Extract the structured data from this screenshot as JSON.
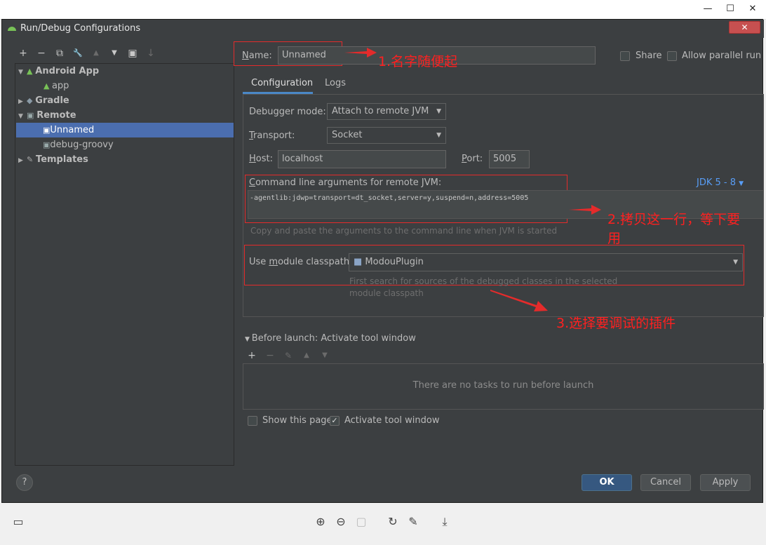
{
  "window": {
    "minimize": "—",
    "maximize": "☐",
    "close": "✕"
  },
  "dialog": {
    "title": "Run/Debug Configurations",
    "close": "✕"
  },
  "toolbar": {
    "add": "+",
    "remove": "−",
    "copy": "⧉",
    "edit": "🔧",
    "up": "▲",
    "down": "▼",
    "folder": "▣",
    "sort": "↓"
  },
  "tree": {
    "android_app": "Android App",
    "app": "app",
    "gradle": "Gradle",
    "remote": "Remote",
    "unnamed": "Unnamed",
    "debug_groovy": "debug-groovy",
    "templates": "Templates"
  },
  "name_field": {
    "label": "Name:",
    "value": "Unnamed"
  },
  "share": {
    "label": "Share"
  },
  "allow_parallel": {
    "label": "Allow parallel run"
  },
  "tabs": {
    "configuration": "Configuration",
    "logs": "Logs"
  },
  "debugger_mode": {
    "label": "Debugger mode:",
    "value": "Attach to remote JVM"
  },
  "transport": {
    "label": "Transport:",
    "value": "Socket"
  },
  "host": {
    "label": "Host:",
    "value": "localhost"
  },
  "port": {
    "label": "Port:",
    "value": "5005"
  },
  "cmdline": {
    "label": "Command line arguments for remote JVM:",
    "jdk": "JDK 5 - 8",
    "value": "-agentlib:jdwp=transport=dt_socket,server=y,suspend=n,address=5005",
    "hint": "Copy and paste the arguments to the command line when JVM is started"
  },
  "module": {
    "label": "Use module classpath:",
    "value": "ModouPlugin",
    "hint1": "First search for sources of the debugged classes in the selected",
    "hint2": "module classpath"
  },
  "before_launch": {
    "label": "Before launch: Activate tool window",
    "empty": "There are no tasks to run before launch"
  },
  "show_page": {
    "label": "Show this page"
  },
  "activate_tool": {
    "label": "Activate tool window"
  },
  "buttons": {
    "ok": "OK",
    "cancel": "Cancel",
    "apply": "Apply",
    "help": "?"
  },
  "annotations": {
    "a1": "1.名字随便起",
    "a2_line1": "2.拷贝这一行，等下要",
    "a2_line2": "用",
    "a3": "3.选择要调试的插件"
  },
  "colors": {
    "accent": "#4b6eaf",
    "annotation": "#e42b2b",
    "link": "#589df6"
  }
}
